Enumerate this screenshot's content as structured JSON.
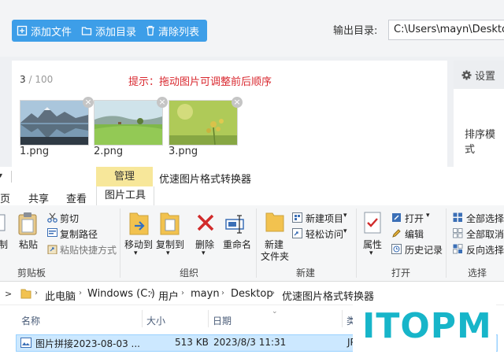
{
  "app": {
    "toolbar": {
      "add_file": "添加文件",
      "add_dir": "添加目录",
      "clear_list": "清除列表",
      "output_label": "输出目录:",
      "output_path": "C:\\Users\\mayn\\Desktop",
      "accent_color": "#3d9ee8"
    },
    "images": {
      "count_current": "3",
      "count_sep_max": " / 100",
      "hint": "提示：拖动图片可调整前后顺序",
      "items": [
        {
          "name": "1.png",
          "remove": "×"
        },
        {
          "name": "2.png",
          "remove": "×"
        },
        {
          "name": "3.png",
          "remove": "×"
        }
      ]
    },
    "side": {
      "settings": "设置",
      "sort_label": "排序模式"
    }
  },
  "explorer": {
    "ctx_group": "管理",
    "title": "优速图片格式转换器",
    "tabs": [
      "页",
      "共享",
      "查看"
    ],
    "ctx_tab": "图片工具",
    "ribbon": {
      "paste_cut_label": "制",
      "paste": "粘贴",
      "cut": "剪切",
      "copy_path": "复制路径",
      "paste_shortcut": "粘贴快捷方式",
      "clipboard": "剪贴板",
      "move_to": "移动到",
      "copy_to": "复制到",
      "delete": "删除",
      "rename": "重命名",
      "organize": "组织",
      "new_folder_1": "新建",
      "new_folder_2": "文件夹",
      "new_item": "新建项目",
      "easy_access": "轻松访问",
      "new_group": "新建",
      "properties": "属性",
      "open": "打开",
      "edit": "编辑",
      "history": "历史记录",
      "open_group": "打开",
      "select_all": "全部选择",
      "select_none": "全部取消",
      "invert": "反向选择",
      "select_group": "选择"
    },
    "address": [
      "此电脑",
      "Windows (C:)",
      "用户",
      "mayn",
      "Desktop",
      "优速图片格式转换器"
    ],
    "columns": {
      "name": "名称",
      "size": "大小",
      "date": "日期",
      "type": "类"
    },
    "files": [
      {
        "name": "图片拼接2023-08-03 ...",
        "size": "513 KB",
        "date": "2023/8/3 11:31",
        "type": "JP"
      }
    ]
  },
  "watermark": "ITOPM"
}
